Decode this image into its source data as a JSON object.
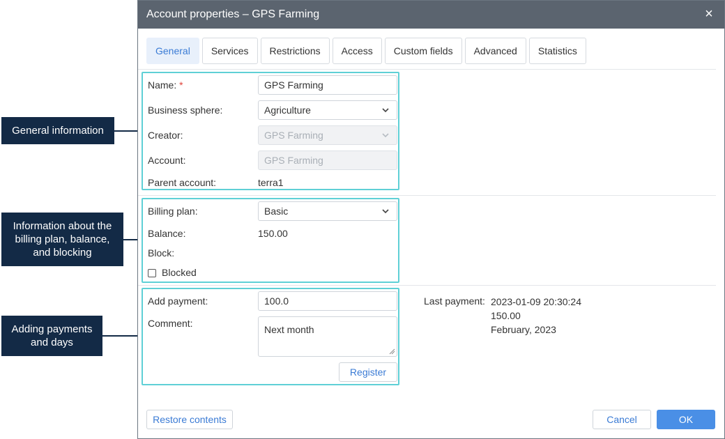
{
  "callouts": {
    "general": "General information",
    "billing": "Information about the\nbilling plan, balance,\nand blocking",
    "payments": "Adding payments\nand days"
  },
  "dialog": {
    "title": "Account properties – GPS Farming",
    "close_glyph": "×"
  },
  "tabs": [
    {
      "label": "General",
      "active": true
    },
    {
      "label": "Services"
    },
    {
      "label": "Restrictions"
    },
    {
      "label": "Access"
    },
    {
      "label": "Custom fields"
    },
    {
      "label": "Advanced"
    },
    {
      "label": "Statistics"
    }
  ],
  "general": {
    "name_label": "Name:",
    "required_mark": "*",
    "name_value": "GPS Farming",
    "business_label": "Business sphere:",
    "business_value": "Agriculture",
    "creator_label": "Creator:",
    "creator_value": "GPS Farming",
    "account_label": "Account:",
    "account_value": "GPS Farming",
    "parent_label": "Parent account:",
    "parent_value": "terra1"
  },
  "billing": {
    "plan_label": "Billing plan:",
    "plan_value": "Basic",
    "balance_label": "Balance:",
    "balance_value": "150.00",
    "block_label": "Block:",
    "blocked_label": "Blocked",
    "blocked_checked": false
  },
  "payments": {
    "add_label": "Add payment:",
    "add_value": "100.0",
    "comment_label": "Comment:",
    "comment_value": "Next month",
    "register_label": "Register",
    "last_payment_label": "Last payment:",
    "last_payment_date": "2023-01-09 20:30:24",
    "last_payment_amount": "150.00",
    "last_payment_period": "February, 2023"
  },
  "footer": {
    "restore_label": "Restore contents",
    "cancel_label": "Cancel",
    "ok_label": "OK"
  },
  "colors": {
    "title_bar": "#5b646f",
    "accent": "#3a7bd5",
    "section_outline": "#5fd0d6",
    "callout_bg": "#132a46"
  }
}
